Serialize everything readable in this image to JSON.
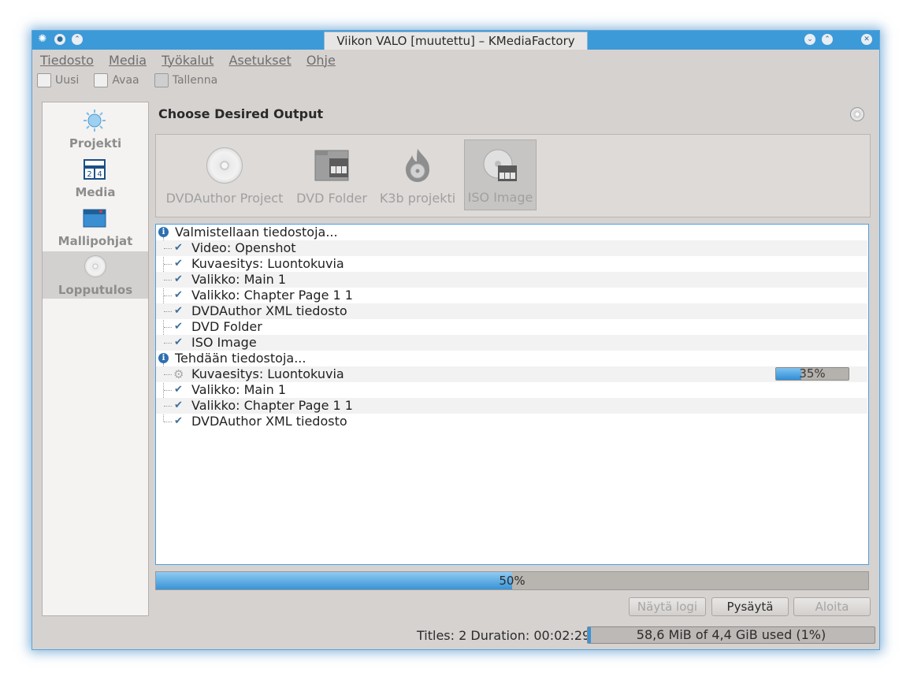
{
  "window": {
    "title": "Viikon VALO [muutettu] – KMediaFactory"
  },
  "menu": [
    "Tiedosto",
    "Media",
    "Työkalut",
    "Asetukset",
    "Ohje"
  ],
  "toolbar": {
    "new_label": "Uusi",
    "open_label": "Avaa",
    "save_label": "Tallenna"
  },
  "sidebar": [
    {
      "label": "Projekti",
      "icon": "project-icon"
    },
    {
      "label": "Media",
      "icon": "media-icon"
    },
    {
      "label": "Mallipohjat",
      "icon": "templates-icon"
    },
    {
      "label": "Lopputulos",
      "icon": "output-icon",
      "selected": true
    }
  ],
  "main": {
    "title": "Choose Desired Output",
    "outputs": [
      {
        "label": "DVDAuthor Project",
        "icon": "disc-icon"
      },
      {
        "label": "DVD Folder",
        "icon": "dvd-folder-icon"
      },
      {
        "label": "K3b projekti",
        "icon": "k3b-icon"
      },
      {
        "label": "ISO Image",
        "icon": "iso-image-icon",
        "selected": true
      }
    ]
  },
  "log": {
    "group1": {
      "title": "Valmistellaan tiedostoja...",
      "items": [
        "Video: Openshot",
        "Kuvaesitys: Luontokuvia",
        "Valikko: Main 1",
        "Valikko: Chapter Page 1 1",
        "DVDAuthor XML tiedosto",
        "DVD Folder",
        "ISO Image"
      ]
    },
    "group2": {
      "title": "Tehdään tiedostoja...",
      "items": [
        {
          "label": "Kuvaesitys: Luontokuvia",
          "status": "running",
          "progress_text": "35%",
          "progress": 0.35
        },
        {
          "label": "Valikko: Main 1",
          "status": "done"
        },
        {
          "label": "Valikko: Chapter Page 1 1",
          "status": "done"
        },
        {
          "label": "DVDAuthor XML tiedosto",
          "status": "done"
        }
      ]
    }
  },
  "progress": {
    "value": 0.5,
    "text": "50%"
  },
  "buttons": {
    "show_log": "Näytä logi",
    "stop": "Pysäytä",
    "start": "Aloita"
  },
  "status": {
    "info": "Titles: 2 Duration: 00:02:29",
    "usage_text": "58,6 MiB of 4,4 GiB used (1%)",
    "usage": 0.01
  },
  "colors": {
    "accent": "#3c9ad8",
    "progress": "#3794d8",
    "check": "#3d6f9e"
  }
}
